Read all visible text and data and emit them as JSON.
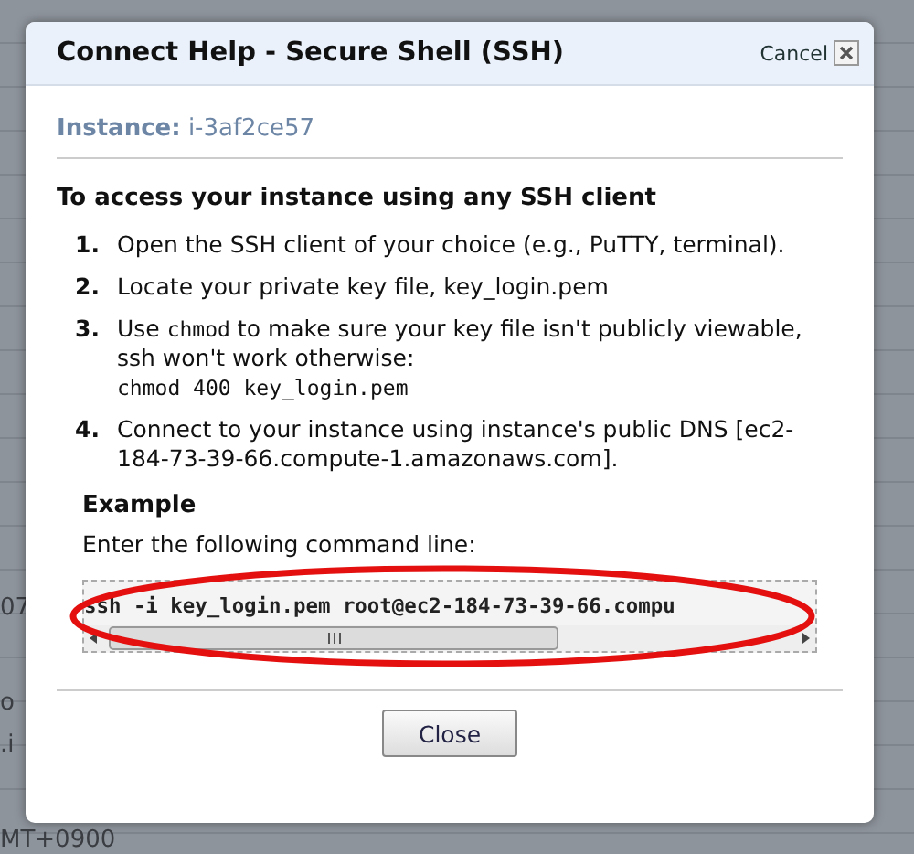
{
  "background": {
    "fragments": [
      "07",
      "o",
      ".i",
      "MT+0900"
    ]
  },
  "dialog": {
    "title": "Connect Help - Secure Shell (SSH)",
    "cancel": "Cancel",
    "instance_label": "Instance:",
    "instance_id": "i-3af2ce57",
    "heading": "To access your instance using any SSH client",
    "steps": [
      {
        "number": "1.",
        "parts": [
          {
            "kind": "text",
            "text": "Open the SSH client of your choice (e.g., PuTTY, terminal)."
          }
        ]
      },
      {
        "number": "2.",
        "parts": [
          {
            "kind": "text",
            "text": "Locate your private key file, key_login.pem"
          }
        ]
      },
      {
        "number": "3.",
        "parts": [
          {
            "kind": "text",
            "text": "Use "
          },
          {
            "kind": "code",
            "text": "chmod"
          },
          {
            "kind": "text",
            "text": " to make sure your key file isn't publicly viewable, ssh won't work otherwise:"
          }
        ],
        "code_line": "chmod 400 key_login.pem"
      },
      {
        "number": "4.",
        "parts": [
          {
            "kind": "text",
            "text": "Connect to your instance using instance's public DNS [ec2-184-73-39-66.compute-1.amazonaws.com]."
          }
        ]
      }
    ],
    "example_heading": "Example",
    "example_intro": "Enter the following command line:",
    "command": "ssh -i key_login.pem root@ec2-184-73-39-66.compu",
    "close_button": "Close"
  }
}
